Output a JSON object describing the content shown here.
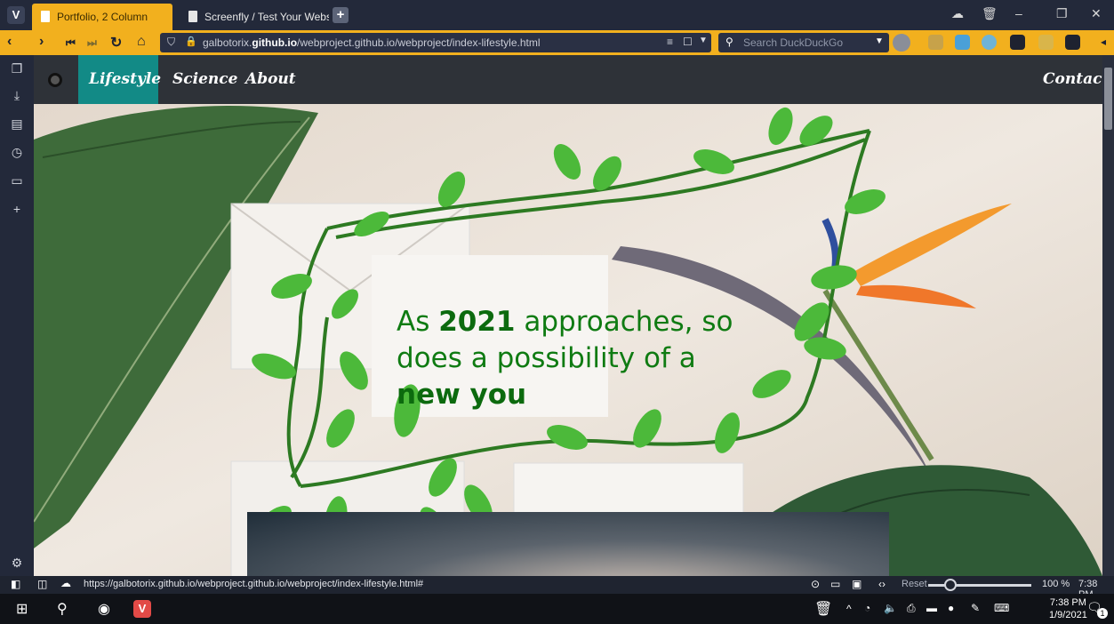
{
  "browser": {
    "tabs": [
      {
        "label": "Portfolio, 2 Column",
        "active": true
      },
      {
        "label": "Screenfly / Test Your Websit",
        "active": false
      }
    ],
    "address": {
      "url_prefix": "galbotorix.",
      "url_domain": "github.io",
      "url_path": "/webproject.github.io/webproject/index-lifestyle.html"
    },
    "search_placeholder": "Search DuckDuckGo",
    "accent_color": "#f2b01e"
  },
  "site": {
    "nav": {
      "items": [
        "Lifestyle",
        "Science",
        "About"
      ],
      "contact": "Contact",
      "active_color": "#128a86"
    },
    "hero": {
      "line1_pre": "As ",
      "line1_bold": "2021",
      "line1_post": " approaches, so",
      "line2": "does a possibility of a",
      "line3_bold": "new you",
      "text_color": "#0f7b12"
    }
  },
  "statusbar": {
    "link_url": "https://galbotorix.github.io/webproject.github.io/webproject/index-lifestyle.html#",
    "reset_label": "Reset",
    "zoom": "100 %",
    "time": "7:38 PM"
  },
  "taskbar": {
    "time": "7:38 PM",
    "date": "1/9/2021",
    "notification_count": "1"
  }
}
